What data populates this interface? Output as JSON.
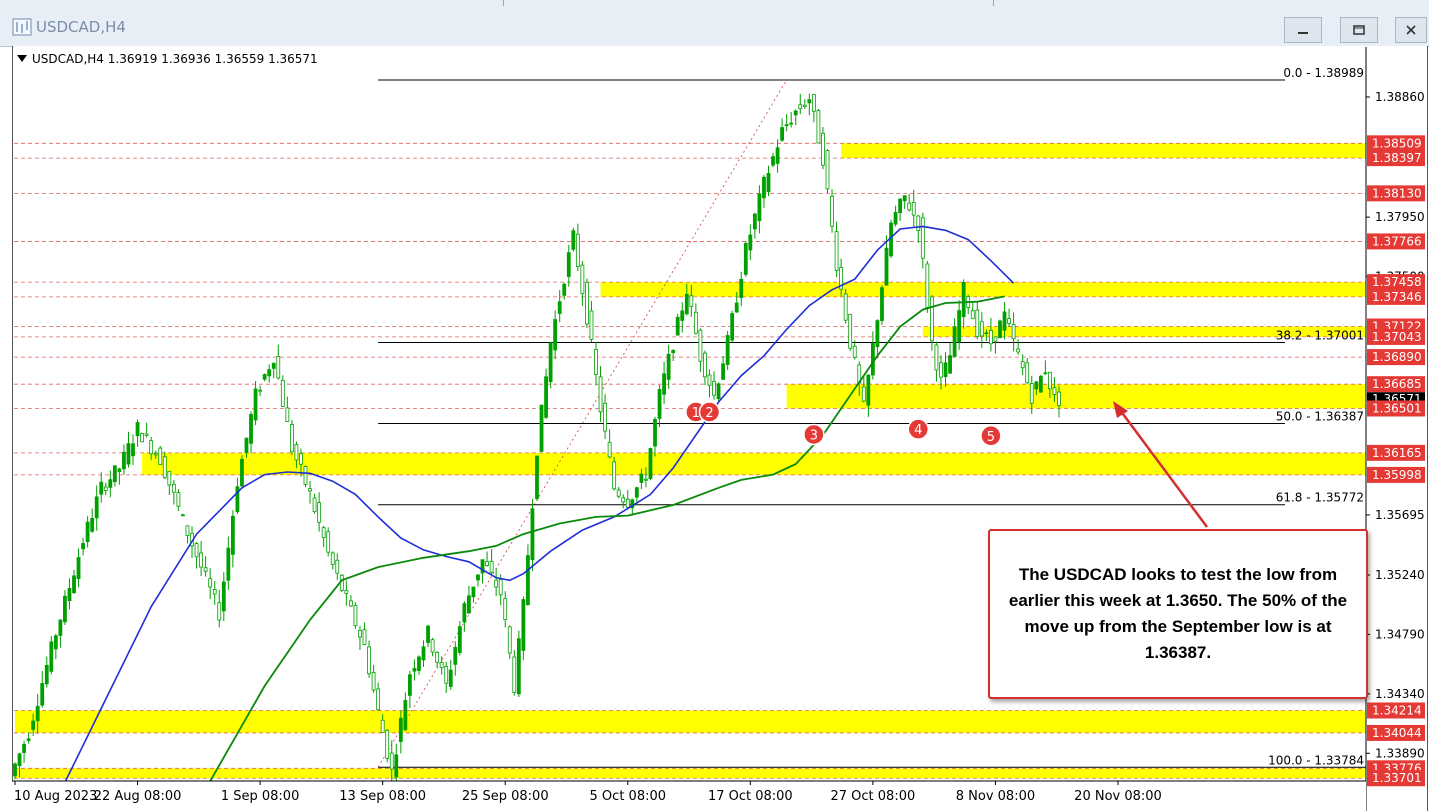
{
  "window": {
    "title": "USDCAD,H4",
    "symbol_info": "USDCAD,H4  1.36919 1.36936 1.36559 1.36571"
  },
  "colors": {
    "zone": "#ffff00",
    "ma_blue": "#1f2fd6",
    "ma_green": "#0a8a0a",
    "candle": "#00a000",
    "annotation_border": "#d32f2f",
    "arrow": "#d32f2f",
    "marker": "#e53935"
  },
  "annotation": {
    "text": "The USDCAD looks to test the low from earlier this week at 1.3650. The 50% of the move up from the September low is at 1.36387."
  },
  "chart_data": {
    "type": "candlestick",
    "symbol": "USDCAD",
    "timeframe": "H4",
    "ohlc_last": {
      "open": 1.36919,
      "high": 1.36936,
      "low": 1.36559,
      "close": 1.36571
    },
    "ylim": [
      1.3368,
      1.3914
    ],
    "price_ticks": [
      "1.38860",
      "1.37950",
      "1.37500",
      "1.35695",
      "1.35240",
      "1.34790",
      "1.34340",
      "1.33890"
    ],
    "price_tick_values": [
      1.3886,
      1.3795,
      1.375,
      1.35695,
      1.3524,
      1.3479,
      1.3434,
      1.3389
    ],
    "x_ticks": [
      "10 Aug 2023",
      "22 Aug 08:00",
      "1 Sep 08:00",
      "13 Sep 08:00",
      "25 Sep 08:00",
      "5 Oct 08:00",
      "17 Oct 08:00",
      "27 Oct 08:00",
      "8 Nov 08:00",
      "20 Nov 08:00"
    ],
    "x_tick_index": [
      0,
      27,
      54,
      81,
      108,
      135,
      162,
      189,
      216,
      243
    ],
    "n_bars": 270,
    "zones": [
      {
        "from": 1.38397,
        "to": 1.38509,
        "start_bar": 182
      },
      {
        "from": 1.37346,
        "to": 1.37458,
        "start_bar": 129
      },
      {
        "from": 1.37043,
        "to": 1.37122,
        "start_bar": 200
      },
      {
        "from": 1.36501,
        "to": 1.36685,
        "start_bar": 170
      },
      {
        "from": 1.35998,
        "to": 1.36165,
        "start_bar": 28
      },
      {
        "from": 1.34044,
        "to": 1.34214,
        "start_bar": 0
      },
      {
        "from": 1.33701,
        "to": 1.33776,
        "start_bar": 0
      }
    ],
    "price_labels": [
      {
        "text": "1.38509",
        "value": 1.38509,
        "highlight": true
      },
      {
        "text": "1.38397",
        "value": 1.38397,
        "highlight": true
      },
      {
        "text": "1.38130",
        "value": 1.3813,
        "highlight": true
      },
      {
        "text": "1.37766",
        "value": 1.37766,
        "highlight": true
      },
      {
        "text": "1.37458",
        "value": 1.37458,
        "highlight": true
      },
      {
        "text": "1.37346",
        "value": 1.37346,
        "highlight": true
      },
      {
        "text": "1.37122",
        "value": 1.37122,
        "highlight": true
      },
      {
        "text": "1.37043",
        "value": 1.37043,
        "highlight": true
      },
      {
        "text": "1.36890",
        "value": 1.3689,
        "highlight": true
      },
      {
        "text": "1.36685",
        "value": 1.36685,
        "highlight": true
      },
      {
        "text": "1.36571",
        "value": 1.36571,
        "highlight": false,
        "current": true
      },
      {
        "text": "1.36501",
        "value": 1.36501,
        "highlight": true
      },
      {
        "text": "1.36165",
        "value": 1.36165,
        "highlight": true
      },
      {
        "text": "1.35998",
        "value": 1.35998,
        "highlight": true
      },
      {
        "text": "1.34214",
        "value": 1.34214,
        "highlight": true
      },
      {
        "text": "1.34044",
        "value": 1.34044,
        "highlight": true
      },
      {
        "text": "1.33776",
        "value": 1.33776,
        "highlight": true
      },
      {
        "text": "1.33701",
        "value": 1.33701,
        "highlight": true
      }
    ],
    "dashed_levels": [
      1.38509,
      1.38397,
      1.3813,
      1.37766,
      1.37458,
      1.37346,
      1.37122,
      1.37043,
      1.3689,
      1.36685,
      1.36501,
      1.36165,
      1.35998,
      1.34214,
      1.34044,
      1.33776,
      1.33701
    ],
    "fibonacci": [
      {
        "label": "0.0 - 1.38989",
        "value": 1.38989
      },
      {
        "label": "38.2 - 1.37001",
        "value": 1.37001
      },
      {
        "label": "50.0 - 1.36387",
        "value": 1.36387
      },
      {
        "label": "61.8 - 1.35772",
        "value": 1.35772
      },
      {
        "label": "100.0 - 1.33784",
        "value": 1.33784
      }
    ],
    "fib_range_bars": [
      80,
      170
    ],
    "markers": [
      {
        "label": "1",
        "bar": 150,
        "value": 1.3655
      },
      {
        "label": "2",
        "bar": 153,
        "value": 1.3655
      },
      {
        "label": "3",
        "bar": 176,
        "value": 1.3638
      },
      {
        "label": "4",
        "bar": 199,
        "value": 1.3642
      },
      {
        "label": "5",
        "bar": 215,
        "value": 1.3637
      }
    ],
    "ma_blue": [
      [
        0,
        1.3315
      ],
      [
        10,
        1.336
      ],
      [
        20,
        1.343
      ],
      [
        30,
        1.35
      ],
      [
        40,
        1.3555
      ],
      [
        50,
        1.359
      ],
      [
        55,
        1.36
      ],
      [
        60,
        1.3602
      ],
      [
        65,
        1.3601
      ],
      [
        70,
        1.3595
      ],
      [
        75,
        1.3585
      ],
      [
        80,
        1.3568
      ],
      [
        85,
        1.3552
      ],
      [
        90,
        1.3543
      ],
      [
        95,
        1.3538
      ],
      [
        100,
        1.3534
      ],
      [
        103,
        1.3528
      ],
      [
        106,
        1.3522
      ],
      [
        109,
        1.352
      ],
      [
        112,
        1.3525
      ],
      [
        118,
        1.3542
      ],
      [
        125,
        1.3558
      ],
      [
        132,
        1.3568
      ],
      [
        140,
        1.3585
      ],
      [
        145,
        1.3605
      ],
      [
        150,
        1.363
      ],
      [
        155,
        1.3655
      ],
      [
        160,
        1.3675
      ],
      [
        165,
        1.369
      ],
      [
        170,
        1.371
      ],
      [
        175,
        1.3728
      ],
      [
        180,
        1.374
      ],
      [
        185,
        1.3748
      ],
      [
        190,
        1.377
      ],
      [
        195,
        1.3786
      ],
      [
        200,
        1.3788
      ],
      [
        205,
        1.3785
      ],
      [
        210,
        1.3778
      ],
      [
        215,
        1.3762
      ],
      [
        220,
        1.3745
      ]
    ],
    "ma_green": [
      [
        36,
        1.3326
      ],
      [
        45,
        1.338
      ],
      [
        55,
        1.344
      ],
      [
        65,
        1.349
      ],
      [
        72,
        1.352
      ],
      [
        80,
        1.353
      ],
      [
        90,
        1.3537
      ],
      [
        100,
        1.3542
      ],
      [
        106,
        1.3546
      ],
      [
        112,
        1.3555
      ],
      [
        120,
        1.3563
      ],
      [
        128,
        1.3568
      ],
      [
        135,
        1.3569
      ],
      [
        145,
        1.3577
      ],
      [
        155,
        1.359
      ],
      [
        160,
        1.3596
      ],
      [
        167,
        1.36
      ],
      [
        172,
        1.3608
      ],
      [
        178,
        1.363
      ],
      [
        184,
        1.366
      ],
      [
        190,
        1.369
      ],
      [
        195,
        1.3712
      ],
      [
        200,
        1.3725
      ],
      [
        205,
        1.373
      ],
      [
        212,
        1.3731
      ],
      [
        218,
        1.3735
      ]
    ],
    "price_path": [
      [
        0,
        1.3372
      ],
      [
        4,
        1.3405
      ],
      [
        10,
        1.348
      ],
      [
        16,
        1.355
      ],
      [
        20,
        1.359
      ],
      [
        24,
        1.3605
      ],
      [
        28,
        1.3635
      ],
      [
        33,
        1.3612
      ],
      [
        38,
        1.3565
      ],
      [
        42,
        1.353
      ],
      [
        46,
        1.3495
      ],
      [
        50,
        1.3595
      ],
      [
        54,
        1.366
      ],
      [
        58,
        1.369
      ],
      [
        62,
        1.362
      ],
      [
        66,
        1.3585
      ],
      [
        70,
        1.354
      ],
      [
        74,
        1.3505
      ],
      [
        78,
        1.347
      ],
      [
        81,
        1.342
      ],
      [
        84,
        1.3375
      ],
      [
        88,
        1.345
      ],
      [
        92,
        1.348
      ],
      [
        96,
        1.344
      ],
      [
        100,
        1.35
      ],
      [
        104,
        1.3535
      ],
      [
        108,
        1.351
      ],
      [
        111,
        1.344
      ],
      [
        113,
        1.35
      ],
      [
        116,
        1.362
      ],
      [
        119,
        1.37
      ],
      [
        122,
        1.375
      ],
      [
        124,
        1.378
      ],
      [
        127,
        1.372
      ],
      [
        130,
        1.365
      ],
      [
        133,
        1.359
      ],
      [
        136,
        1.358
      ],
      [
        140,
        1.36
      ],
      [
        143,
        1.366
      ],
      [
        146,
        1.37
      ],
      [
        149,
        1.374
      ],
      [
        152,
        1.369
      ],
      [
        155,
        1.366
      ],
      [
        158,
        1.37
      ],
      [
        162,
        1.377
      ],
      [
        166,
        1.382
      ],
      [
        170,
        1.386
      ],
      [
        173,
        1.3875
      ],
      [
        176,
        1.3885
      ],
      [
        179,
        1.384
      ],
      [
        182,
        1.376
      ],
      [
        185,
        1.37
      ],
      [
        188,
        1.365
      ],
      [
        191,
        1.372
      ],
      [
        194,
        1.379
      ],
      [
        197,
        1.381
      ],
      [
        200,
        1.379
      ],
      [
        203,
        1.37
      ],
      [
        205,
        1.367
      ],
      [
        207,
        1.369
      ],
      [
        210,
        1.374
      ],
      [
        213,
        1.371
      ],
      [
        216,
        1.37
      ],
      [
        219,
        1.372
      ],
      [
        222,
        1.369
      ],
      [
        225,
        1.366
      ],
      [
        228,
        1.368
      ],
      [
        230,
        1.3657
      ]
    ]
  }
}
